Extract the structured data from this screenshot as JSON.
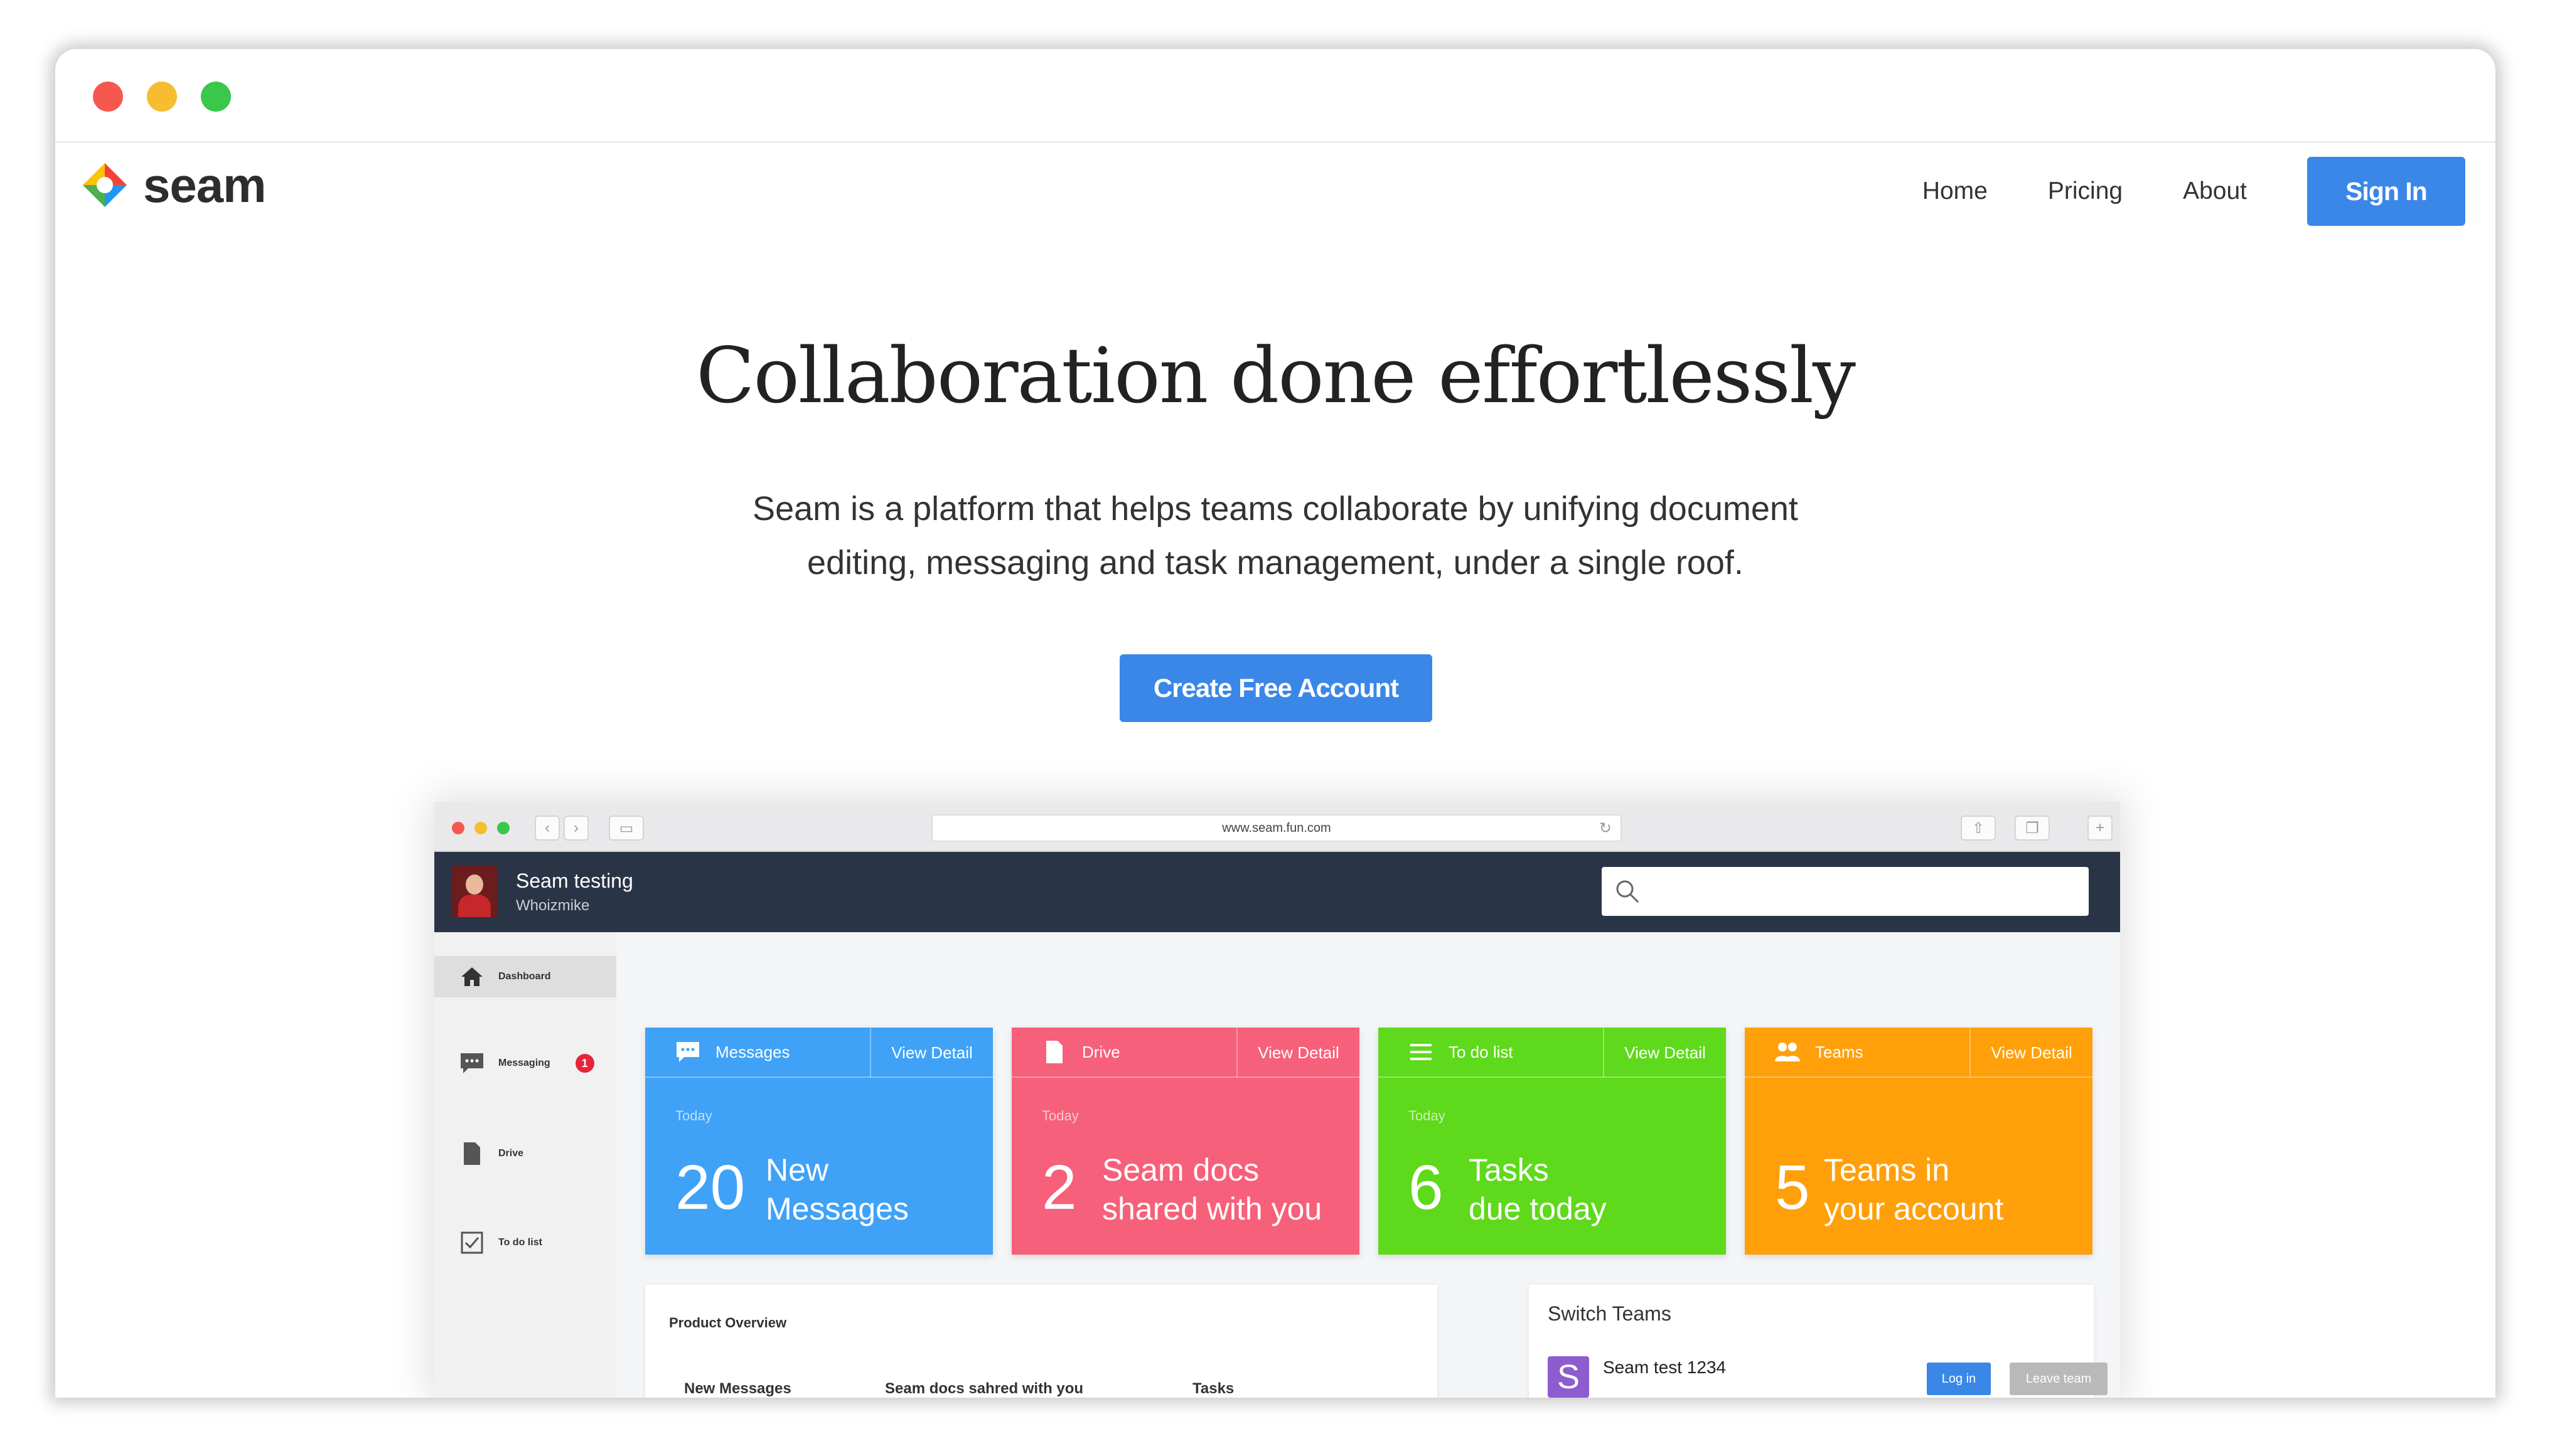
{
  "window": {
    "controls": [
      "close",
      "minimize",
      "zoom"
    ]
  },
  "brand": {
    "logo_text": "seam",
    "logo_colors": [
      "#f44336",
      "#ffc107",
      "#4caf50",
      "#2196f3"
    ]
  },
  "nav": {
    "links": [
      {
        "label": "Home"
      },
      {
        "label": "Pricing"
      },
      {
        "label": "About"
      }
    ],
    "signin_label": "Sign In"
  },
  "hero": {
    "title": "Collaboration done effortlessly",
    "subtitle_line1": "Seam is a platform that helps teams collaborate by unifying document",
    "subtitle_line2": "editing, messaging and task management, under a single roof.",
    "cta_label": "Create Free Account"
  },
  "mockup": {
    "url": "www.seam.fun.com",
    "user": {
      "name": "Seam testing",
      "handle": "Whoizmike"
    },
    "sidebar": [
      {
        "label": "Dashboard",
        "icon": "home-icon",
        "active": true
      },
      {
        "label": "Messaging",
        "icon": "message-icon",
        "badge": "1"
      },
      {
        "label": "Drive",
        "icon": "document-icon"
      },
      {
        "label": "To do list",
        "icon": "checkbox-icon"
      }
    ],
    "cards": [
      {
        "title": "Messages",
        "view": "View Detail",
        "today": "Today",
        "count": "20",
        "line1": "New",
        "line2": "Messages",
        "color": "#3fa2f7",
        "icon": "message-icon"
      },
      {
        "title": "Drive",
        "view": "View Detail",
        "today": "Today",
        "count": "2",
        "line1": "Seam docs",
        "line2": "shared with you",
        "color": "#f7607a",
        "icon": "document-icon"
      },
      {
        "title": "To do list",
        "view": "View Detail",
        "today": "Today",
        "count": "6",
        "line1": "Tasks",
        "line2": "due today",
        "color": "#5fd91b",
        "icon": "list-icon"
      },
      {
        "title": "Teams",
        "view": "View Detail",
        "today": "",
        "count": "5",
        "line1": "Teams in",
        "line2": "your account",
        "color": "#ffa00a",
        "icon": "people-icon"
      }
    ],
    "product_overview": {
      "title": "Product Overview",
      "columns": [
        "New Messages",
        "Seam docs sahred with you",
        "Tasks"
      ]
    },
    "switch_teams": {
      "title": "Switch Teams",
      "team_initial": "S",
      "team_name": "Seam test 1234",
      "login_label": "Log in",
      "leave_label": "Leave team"
    }
  }
}
